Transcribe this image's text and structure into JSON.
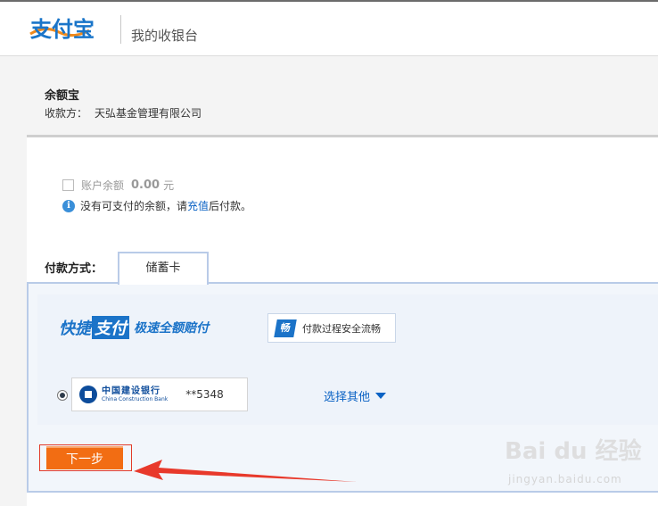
{
  "header": {
    "logo_text": "支付宝",
    "title": "我的收银台"
  },
  "order": {
    "name": "余额宝",
    "payee_label": "收款方：",
    "payee_name": "天弘基金管理有限公司"
  },
  "balance": {
    "label": "账户余额",
    "amount": "0.00",
    "unit": "元",
    "info_prefix": "没有可支付的余额，请",
    "info_link": "充值",
    "info_suffix": "后付款。"
  },
  "payment": {
    "method_label": "付款方式：",
    "tab_label": "储蓄卡",
    "quickpay_a": "快捷",
    "quickpay_b": "支付",
    "quickpay_sub": "极速全额赔付",
    "secure_icon_char": "畅",
    "secure_text": "付款过程安全流畅",
    "bank_name_cn": "中国建设银行",
    "bank_name_en": "China Construction Bank",
    "card_number": "**5348",
    "choose_other": "选择其他",
    "next_button": "下一步"
  },
  "watermark": {
    "text": "Bai du 经验",
    "sub": "jingyan.baidu.com"
  },
  "colors": {
    "accent_blue": "#1b73c8",
    "button_orange": "#f26d13",
    "annotation_red": "#e23b2a"
  }
}
